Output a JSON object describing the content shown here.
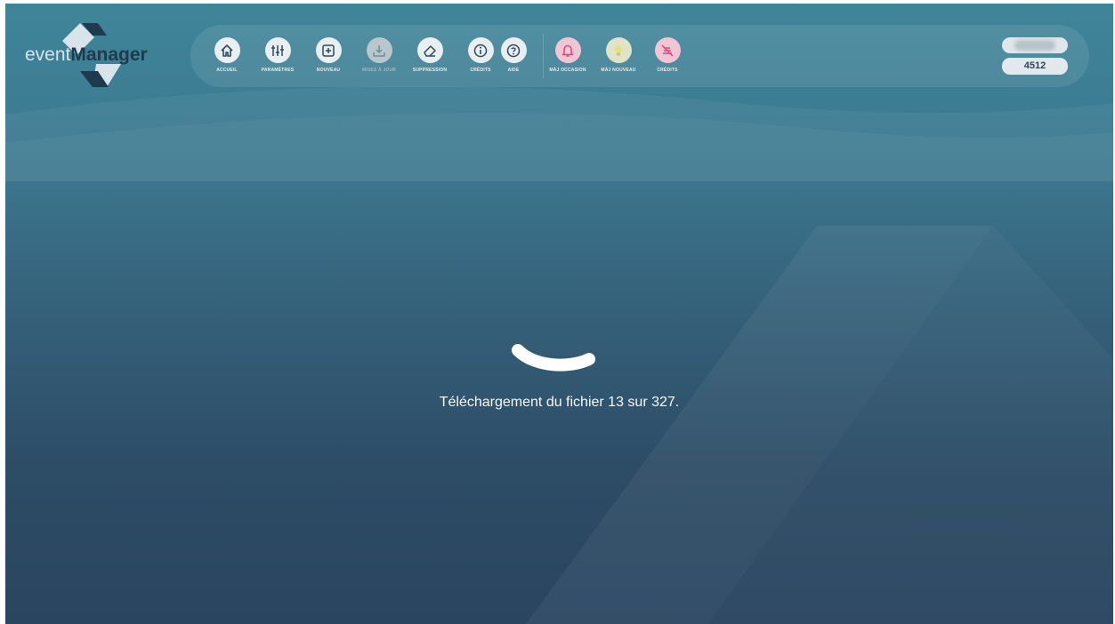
{
  "logo": {
    "part1": "event",
    "part2": "Manager"
  },
  "toolbar": {
    "buttons": [
      {
        "label": "ACCUEIL",
        "icon": "home-icon",
        "state": "enabled"
      },
      {
        "label": "PARAMÈTRES",
        "icon": "sliders-icon",
        "state": "enabled"
      },
      {
        "label": "NOUVEAU",
        "icon": "plus-square-icon",
        "state": "enabled"
      },
      {
        "label": "MISES À JOUR",
        "icon": "download-icon",
        "state": "disabled"
      },
      {
        "label": "SUPPRESSION",
        "icon": "eraser-icon",
        "state": "enabled"
      },
      {
        "label": "CRÉDITS",
        "icon": "info-icon",
        "state": "enabled"
      },
      {
        "label": "AIDE",
        "icon": "help-icon",
        "state": "enabled"
      },
      {
        "label": "MÀJ OCCASION",
        "icon": "bell-icon",
        "state": "alert"
      },
      {
        "label": "MÀJ NOUVEAU",
        "icon": "bulb-icon",
        "state": "alert"
      },
      {
        "label": "CRÉDITS",
        "icon": "credits-off-icon",
        "state": "alert"
      }
    ]
  },
  "user": {
    "code": "4512"
  },
  "loading": {
    "message": "Téléchargement du fichier 13 sur 327."
  },
  "colors": {
    "accent_pink": "#e0457b",
    "bulb_yellow": "#e8df8a",
    "icon_dark": "#2e4a5c",
    "bg_top": "#3f8599",
    "bg_bottom": "#2a4560"
  }
}
